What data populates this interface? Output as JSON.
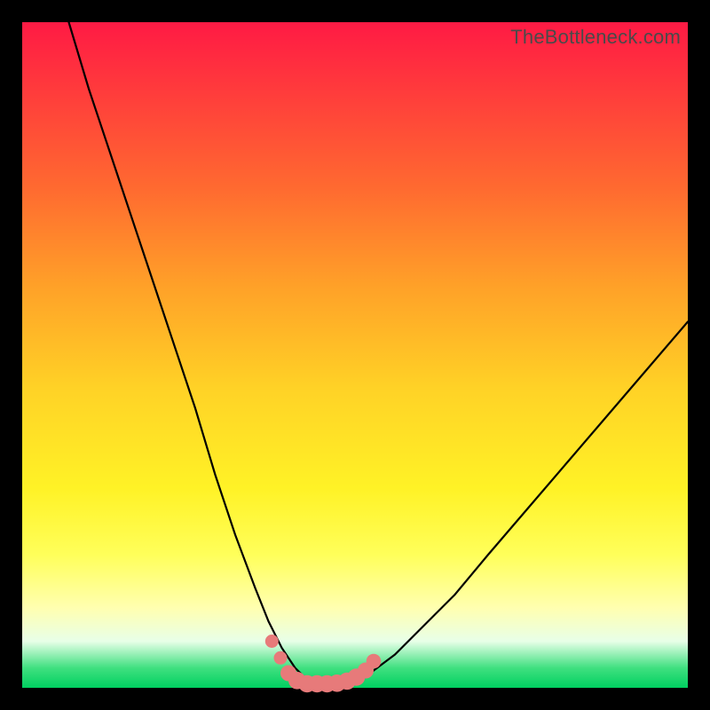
{
  "watermark": "TheBottleneck.com",
  "chart_data": {
    "type": "line",
    "title": "",
    "xlabel": "",
    "ylabel": "",
    "xlim": [
      0,
      100
    ],
    "ylim": [
      0,
      100
    ],
    "grid": false,
    "series": [
      {
        "name": "bottleneck-curve",
        "x": [
          7,
          10,
          14,
          18,
          22,
          26,
          29,
          32,
          35,
          37,
          39,
          41,
          43,
          45,
          48,
          52,
          56,
          60,
          65,
          70,
          76,
          82,
          88,
          94,
          100
        ],
        "values": [
          100,
          90,
          78,
          66,
          54,
          42,
          32,
          23,
          15,
          10,
          6,
          3,
          1,
          1,
          1,
          2,
          5,
          9,
          14,
          20,
          27,
          34,
          41,
          48,
          55
        ]
      }
    ],
    "markers": {
      "name": "bottom-markers",
      "color": "#e77a7a",
      "points": [
        {
          "x": 37.5,
          "y": 7.0,
          "r": 1.0
        },
        {
          "x": 38.8,
          "y": 4.5,
          "r": 1.0
        },
        {
          "x": 40.0,
          "y": 2.2,
          "r": 1.2
        },
        {
          "x": 41.3,
          "y": 1.1,
          "r": 1.3
        },
        {
          "x": 42.8,
          "y": 0.6,
          "r": 1.3
        },
        {
          "x": 44.3,
          "y": 0.6,
          "r": 1.3
        },
        {
          "x": 45.8,
          "y": 0.6,
          "r": 1.3
        },
        {
          "x": 47.3,
          "y": 0.7,
          "r": 1.3
        },
        {
          "x": 48.8,
          "y": 1.0,
          "r": 1.3
        },
        {
          "x": 50.2,
          "y": 1.6,
          "r": 1.3
        },
        {
          "x": 51.6,
          "y": 2.6,
          "r": 1.2
        },
        {
          "x": 52.8,
          "y": 4.0,
          "r": 1.1
        }
      ]
    }
  }
}
